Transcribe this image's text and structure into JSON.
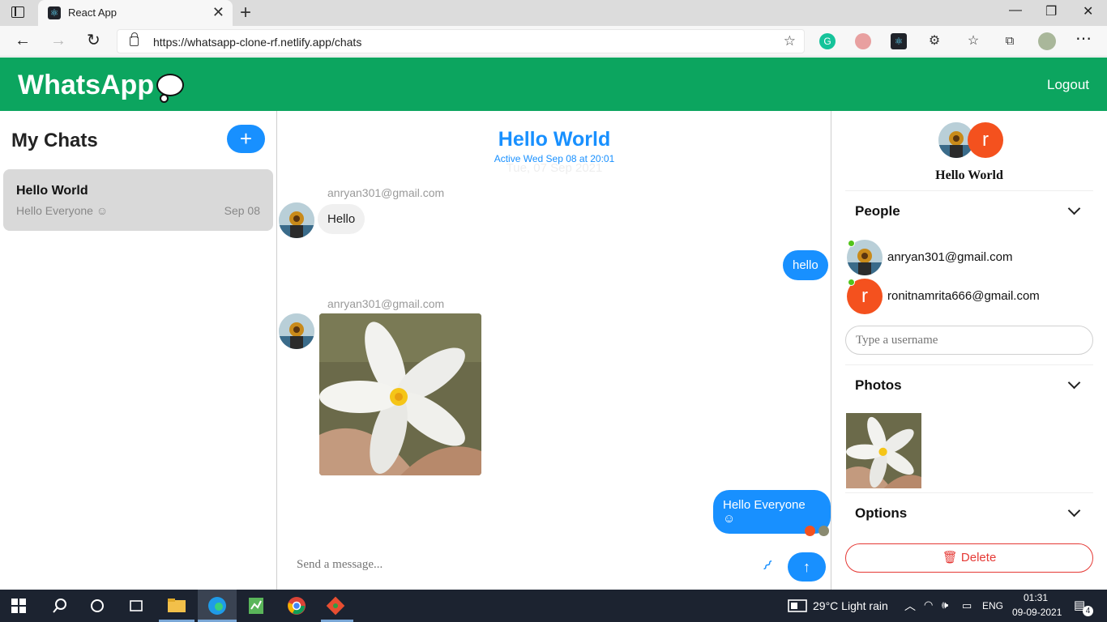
{
  "browser": {
    "tab_title": "React App",
    "url": "https://whatsapp-clone-rf.netlify.app/chats",
    "tab_close": "✕",
    "new_tab": "+",
    "minimize": "—",
    "restore": "❐",
    "close": "✕",
    "back": "←",
    "forward": "→",
    "reload": "↻",
    "menu": "⋯"
  },
  "header": {
    "brand": "WhatsApp",
    "logout": "Logout"
  },
  "left": {
    "title": "My Chats",
    "add_label": "+",
    "chat": {
      "title": "Hello World",
      "last_message": "Hello Everyone ☺",
      "date": "Sep 08"
    }
  },
  "center": {
    "title": "Hello World",
    "active": "Active Wed Sep 08 at 20:01",
    "ghost_date": "Tue, 07 Sep 2021",
    "messages": [
      {
        "sender": "anryan301@gmail.com",
        "text": "Hello"
      },
      {
        "text": "hello"
      },
      {
        "sender": "anryan301@gmail.com"
      },
      {
        "text": "Hello Everyone ☺"
      }
    ],
    "composer_placeholder": "Send a message...",
    "send_icon": "↑",
    "attach_icon": "⌇"
  },
  "right": {
    "chat_title": "Hello World",
    "avatar_initial": "r",
    "people_title": "People",
    "people": [
      {
        "email": "anryan301@gmail.com"
      },
      {
        "email": "ronitnamrita666@gmail.com",
        "initial": "r"
      }
    ],
    "username_placeholder": "Type a username",
    "photos_title": "Photos",
    "options_title": "Options",
    "delete_label": "Delete"
  },
  "taskbar": {
    "weather": "29°C  Light rain",
    "lang": "ENG",
    "time": "01:31",
    "date": "09-09-2021",
    "notifications": "4"
  },
  "colors": {
    "header_green": "#0ca55f",
    "accent_blue": "#1890ff",
    "danger_red": "#e53935",
    "avatar_orange": "#f4511e",
    "online_green": "#52c41a"
  }
}
